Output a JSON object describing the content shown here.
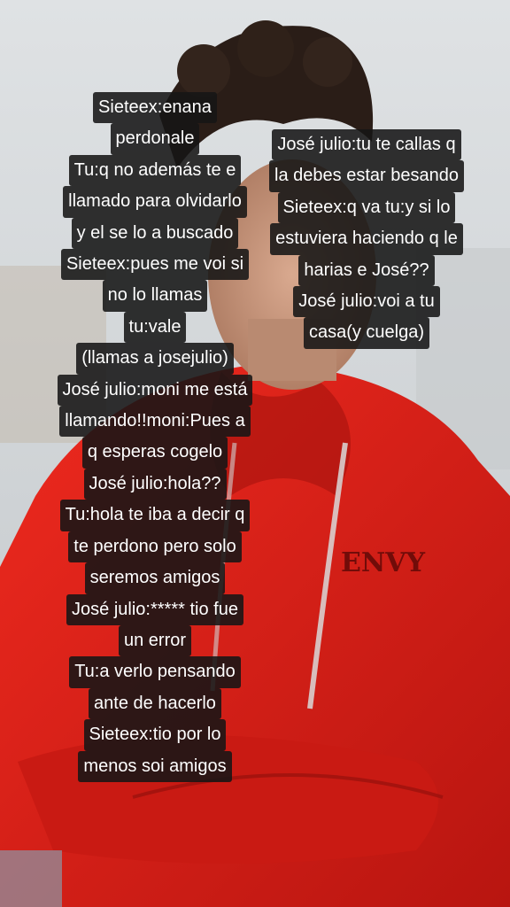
{
  "background": {
    "description_icon": "person-red-hoodie-photo",
    "hoodie_print": "ENVY",
    "colors": {
      "hoodie": "#e0231a",
      "sky": "#d3d7da",
      "hair": "#2a1d17",
      "skin": "#c99a80"
    }
  },
  "caption_left": {
    "lines": [
      "Sieteex:enana",
      "perdonale",
      "Tu:q no además te e",
      "llamado para olvidarlo",
      "y el se lo a buscado",
      "Sieteex:pues me voi si",
      "no lo llamas",
      "tu:vale",
      "(llamas a josejulio)",
      "José julio:moni me está",
      "llamando!!moni:Pues a",
      "q esperas cogelo",
      "José julio:hola??",
      "Tu:hola te iba a decir q",
      "te perdono pero solo",
      "seremos amigos",
      "José julio:***** tio fue",
      "un error",
      "Tu:a verlo pensando",
      "ante de hacerlo",
      "Sieteex:tio por lo",
      "menos soi amigos"
    ]
  },
  "caption_right": {
    "lines": [
      "José julio:tu te callas q",
      "la debes estar besando",
      "Sieteex:q va tu:y si lo",
      "estuviera haciendo q le",
      "harias e José??",
      "José julio:voi a tu",
      "casa(y cuelga)"
    ]
  }
}
